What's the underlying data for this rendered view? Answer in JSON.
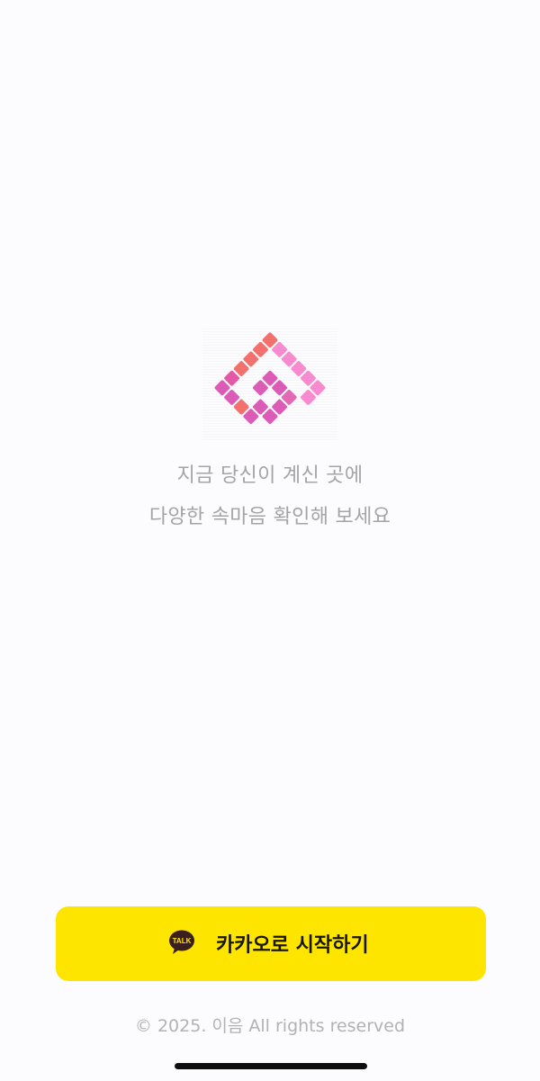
{
  "intro": {
    "tagline_line1": "지금 당신이 계신 곳에",
    "tagline_line2": "다양한 속마음 확인해 보세요"
  },
  "login": {
    "kakao_icon_text": "TALK",
    "kakao_button_label": "카카오로 시작하기",
    "kakao_color": "#fee500"
  },
  "footer": {
    "copyright": "© 2025. 이음 All rights reserved"
  },
  "colors": {
    "logo_coral": "#f4716e",
    "logo_magenta": "#dd5cb8",
    "logo_pink": "#f98bd1",
    "tagline": "#a3a3a8"
  },
  "icons": [
    "app-logo-icon",
    "kakao-talk-icon"
  ]
}
